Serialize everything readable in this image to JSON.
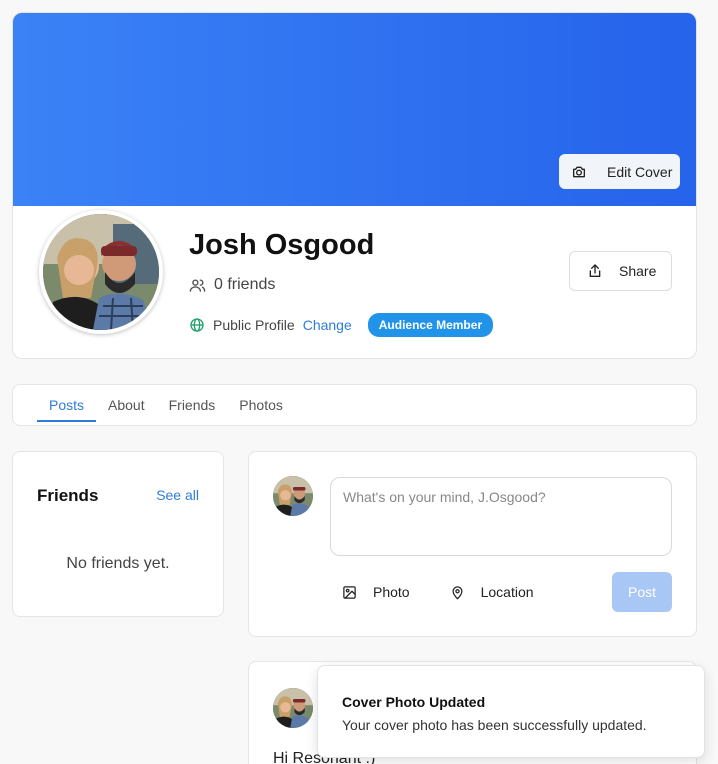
{
  "profile": {
    "name": "Josh Osgood",
    "friends_count": "0 friends",
    "visibility": "Public Profile",
    "change_label": "Change",
    "badge": "Audience Member",
    "edit_cover_label": "Edit Cover",
    "share_label": "Share",
    "cover_colors": [
      "#3b82f6",
      "#2563eb"
    ]
  },
  "tabs": [
    {
      "label": "Posts",
      "active": true
    },
    {
      "label": "About",
      "active": false
    },
    {
      "label": "Friends",
      "active": false
    },
    {
      "label": "Photos",
      "active": false
    }
  ],
  "friends_panel": {
    "title": "Friends",
    "see_all": "See all",
    "empty_text": "No friends yet."
  },
  "composer": {
    "placeholder": "What's on your mind, J.Osgood?",
    "photo_label": "Photo",
    "location_label": "Location",
    "post_label": "Post"
  },
  "post": {
    "text": "Hi Resonant :)"
  },
  "toast": {
    "title": "Cover Photo Updated",
    "message": "Your cover photo has been successfully updated."
  },
  "icons": {
    "camera": "camera-icon",
    "users": "users-icon",
    "globe": "globe-icon",
    "share": "share-icon",
    "image": "image-icon",
    "pin": "map-pin-icon"
  },
  "colors": {
    "accent": "#2f7cd8",
    "badge": "#2193e9",
    "post_button_disabled": "#a9c7f4",
    "globe": "#22a06b"
  }
}
